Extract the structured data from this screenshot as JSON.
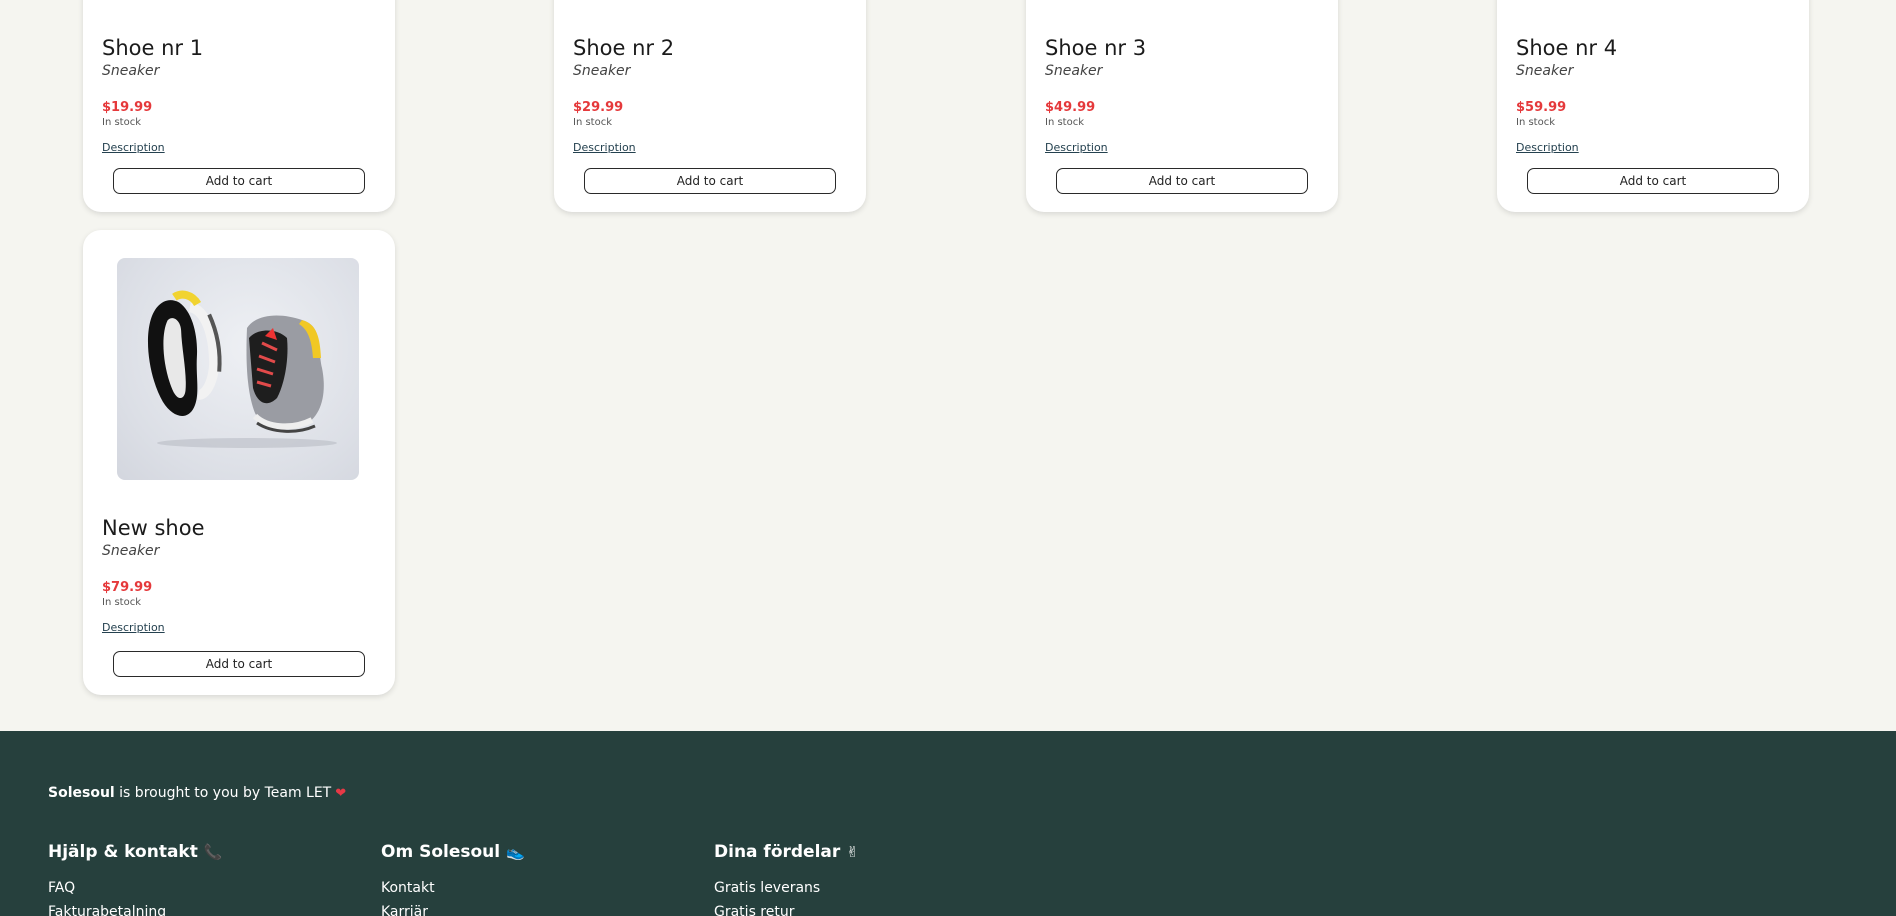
{
  "products": [
    {
      "title": "Shoe nr 1",
      "type": "Sneaker",
      "price": "$19.99",
      "stock": "In stock",
      "description": "Description",
      "button": "Add to cart"
    },
    {
      "title": "Shoe nr 2",
      "type": "Sneaker",
      "price": "$29.99",
      "stock": "In stock",
      "description": "Description",
      "button": "Add to cart"
    },
    {
      "title": "Shoe nr 3",
      "type": "Sneaker",
      "price": "$49.99",
      "stock": "In stock",
      "description": "Description",
      "button": "Add to cart"
    },
    {
      "title": "Shoe nr 4",
      "type": "Sneaker",
      "price": "$59.99",
      "stock": "In stock",
      "description": "Description",
      "button": "Add to cart"
    },
    {
      "title": "New shoe",
      "type": "Sneaker",
      "price": "$79.99",
      "stock": "In stock",
      "description": "Description",
      "button": "Add to cart"
    }
  ],
  "footer": {
    "brand": "Solesoul",
    "byline": " is brought to you by Team LET",
    "columns": [
      {
        "heading": "Hjälp & kontakt",
        "emoji": "📞",
        "links": [
          "FAQ",
          "Fakturabetalning"
        ]
      },
      {
        "heading": "Om Solesoul",
        "emoji": "👟",
        "links": [
          "Kontakt",
          "Karriär"
        ]
      },
      {
        "heading": "Dina fördelar",
        "emoji": "✌",
        "links": [
          "Gratis leverans",
          "Gratis retur"
        ]
      }
    ]
  },
  "colors": {
    "price": "#e5393b",
    "footer_bg": "#26403d",
    "page_bg": "#f5f5f0"
  }
}
